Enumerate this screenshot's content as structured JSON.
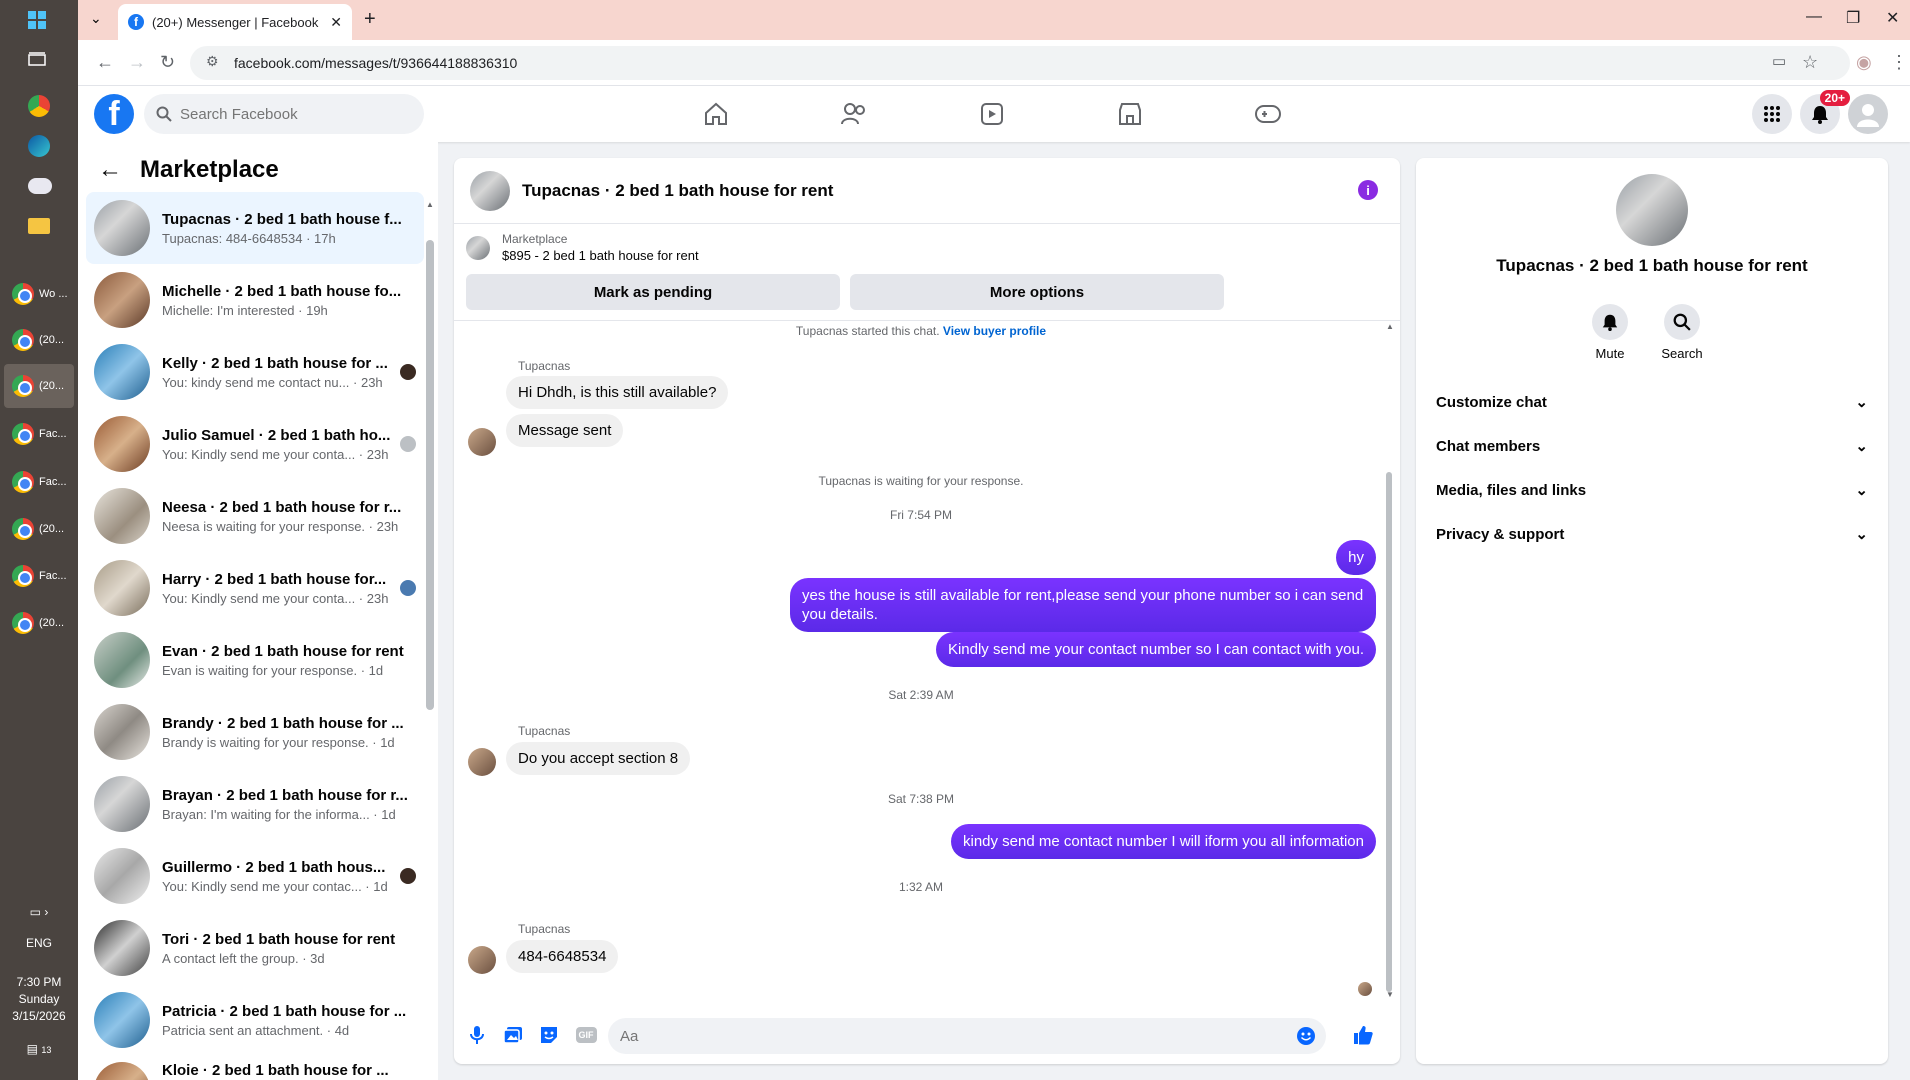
{
  "browser": {
    "tab_title": "(20+) Messenger | Facebook",
    "url": "facebook.com/messages/t/936644188836310"
  },
  "taskbar": {
    "apps": [
      {
        "label": "Wo ..."
      },
      {
        "label": "(20..."
      },
      {
        "label": "(20..."
      },
      {
        "label": "Fac..."
      },
      {
        "label": "Fac..."
      },
      {
        "label": "(20..."
      },
      {
        "label": "Fac..."
      },
      {
        "label": "(20..."
      }
    ],
    "language": "ENG",
    "time": "7:30 PM",
    "day": "Sunday",
    "date": "3/15/2026",
    "notification_count": "13"
  },
  "fb_header": {
    "search_placeholder": "Search Facebook",
    "notification_badge": "20+"
  },
  "left_panel": {
    "title": "Marketplace",
    "conversations": [
      {
        "name": "Tupacnas · 2 bed 1 bath house f...",
        "sub": "Tupacnas: 484-6648534 · 17h"
      },
      {
        "name": "Michelle · 2 bed 1 bath house fo...",
        "sub": "Michelle: I'm interested · 19h"
      },
      {
        "name": "Kelly · 2 bed 1 bath house for ...",
        "sub": "You: kindy send me contact nu... · 23h"
      },
      {
        "name": "Julio Samuel · 2 bed 1 bath ho...",
        "sub": "You: Kindly send me your conta... · 23h"
      },
      {
        "name": "Neesa · 2 bed 1 bath house for r...",
        "sub": "Neesa is waiting for your response. · 23h"
      },
      {
        "name": "Harry · 2 bed 1 bath house for...",
        "sub": "You: Kindly send me your conta... · 23h"
      },
      {
        "name": "Evan · 2 bed 1 bath house for rent",
        "sub": "Evan is waiting for your response. · 1d"
      },
      {
        "name": "Brandy · 2 bed 1 bath house for ...",
        "sub": "Brandy is waiting for your response. · 1d"
      },
      {
        "name": "Brayan · 2 bed 1 bath house for r...",
        "sub": "Brayan: I'm waiting for the informa... · 1d"
      },
      {
        "name": "Guillermo · 2 bed 1 bath hous...",
        "sub": "You: Kindly send me your contac... · 1d"
      },
      {
        "name": "Tori · 2 bed 1 bath house for rent",
        "sub": "A contact left the group. · 3d"
      },
      {
        "name": "Patricia · 2 bed 1 bath house for ...",
        "sub": "Patricia sent an attachment. · 4d"
      },
      {
        "name": "Kloie · 2 bed 1 bath house for ...",
        "sub": ""
      }
    ]
  },
  "chat": {
    "title": "Tupacnas · 2 bed 1 bath house for rent",
    "listing_source": "Marketplace",
    "listing_detail": "$895 - 2 bed 1 bath house for rent",
    "mark_pending": "Mark as pending",
    "more_options": "More options",
    "started_text": "Tupacnas started this chat.",
    "view_profile": "View buyer profile",
    "sender_name": "Tupacnas",
    "msg_in_1": "Hi Dhdh, is this still available?",
    "msg_in_2": "Message sent",
    "waiting_text": "Tupacnas is waiting for your response.",
    "ts_1": "Fri 7:54 PM",
    "msg_out_1": "hy",
    "msg_out_2": "yes the house is still available for rent,please send your phone number so i can send you details.",
    "msg_out_3": "Kindly send me your contact number so I can contact with you.",
    "ts_2": "Sat 2:39 AM",
    "msg_in_3": "Do you accept section 8",
    "ts_3": "Sat 7:38 PM",
    "msg_out_4": "kindy send me contact number I will iform you all information",
    "ts_4": "1:32 AM",
    "msg_in_4": "484-6648534",
    "composer_placeholder": "Aa",
    "gif_label": "GIF"
  },
  "right_panel": {
    "name": "Tupacnas · 2 bed 1 bath house for rent",
    "mute_label": "Mute",
    "search_label": "Search",
    "sections": [
      "Customize chat",
      "Chat members",
      "Media, files and links",
      "Privacy & support"
    ]
  },
  "colors": {
    "fb_blue": "#1877f2",
    "outgoing_bubble": "#6b2cf5",
    "active_conv": "#ebf5ff",
    "tab_bar": "#f7d6cf"
  }
}
